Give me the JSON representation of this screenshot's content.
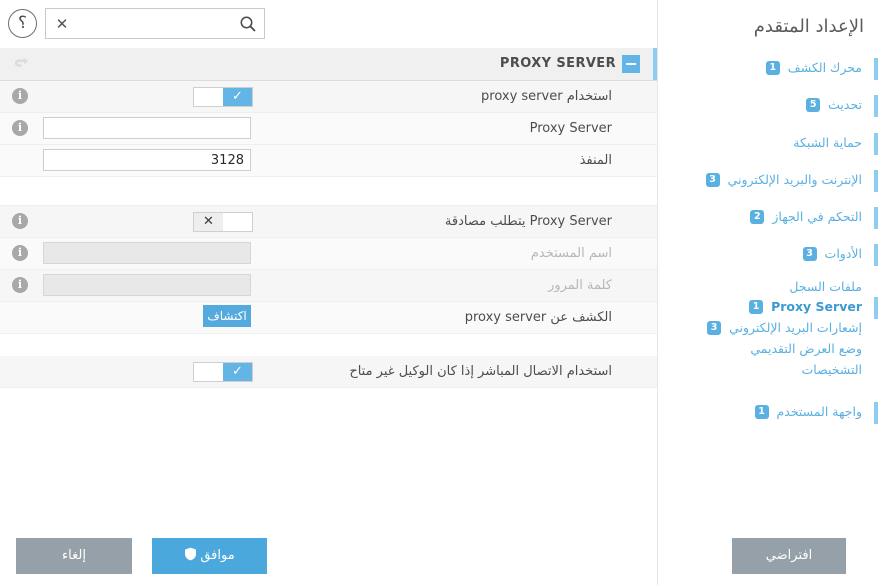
{
  "topbar": {
    "help_icon": "arabic-question-mark-icon",
    "search": {
      "value": "",
      "placeholder": "",
      "clear_glyph": "✕",
      "icon": "search-icon"
    }
  },
  "panel": {
    "title": "PROXY SERVER",
    "collapse_icon": "minus-icon",
    "undo_icon": "redo-arrow-icon",
    "rows": [
      {
        "id": "use-proxy-server",
        "label": "استخدام proxy server",
        "control": "toggle",
        "state": "on",
        "info": true,
        "mark": "✓"
      },
      {
        "id": "proxy-server-host",
        "label": "Proxy Server",
        "control": "text",
        "value": "",
        "info": true,
        "disabled": false
      },
      {
        "id": "proxy-port",
        "label": "المنفذ",
        "control": "text",
        "value": "3128",
        "info": false,
        "disabled": false
      },
      {
        "id": "proxy-requires-auth",
        "label": "Proxy Server يتطلب مصادقة",
        "control": "toggle",
        "state": "off",
        "info": true,
        "mark": "✕"
      },
      {
        "id": "username",
        "label": "اسم المستخدم",
        "control": "text",
        "value": "",
        "info": true,
        "disabled": true
      },
      {
        "id": "password",
        "label": "كلمة المرور",
        "control": "text",
        "value": "",
        "info": true,
        "disabled": true
      },
      {
        "id": "detect-proxy",
        "label": "الكشف عن proxy server",
        "control": "button",
        "button_label": "اكتشاف",
        "info": false
      },
      {
        "id": "direct-connection-fallback",
        "label": "استخدام الاتصال المباشر إذا كان الوكيل غير متاح",
        "control": "toggle",
        "state": "on",
        "info": false,
        "mark": "✓"
      }
    ]
  },
  "sidebar": {
    "title": "الإعداد المتقدم",
    "items": [
      {
        "label": "محرك الكشف",
        "badge": "1",
        "accent": true,
        "sub": false,
        "selected": false
      },
      {
        "label": "تحديث",
        "badge": "5",
        "accent": true,
        "sub": false,
        "selected": false
      },
      {
        "label": "حماية الشبكة",
        "badge": "",
        "accent": true,
        "sub": false,
        "selected": false
      },
      {
        "label": "الإنترنت والبريد الإلكتروني",
        "badge": "3",
        "accent": true,
        "sub": false,
        "selected": false
      },
      {
        "label": "التحكم في الجهاز",
        "badge": "2",
        "accent": true,
        "sub": false,
        "selected": false
      },
      {
        "label": "الأدوات",
        "badge": "3",
        "accent": true,
        "sub": false,
        "selected": false
      },
      {
        "label": "ملفات السجل",
        "badge": "",
        "accent": false,
        "sub": true,
        "selected": false
      },
      {
        "label": "Proxy Server",
        "badge": "1",
        "accent": true,
        "sub": true,
        "selected": true
      },
      {
        "label": "إشعارات البريد الإلكتروني",
        "badge": "3",
        "accent": false,
        "sub": true,
        "selected": false
      },
      {
        "label": "وضع العرض التقديمي",
        "badge": "",
        "accent": false,
        "sub": true,
        "selected": false
      },
      {
        "label": "التشخيصات",
        "badge": "",
        "accent": false,
        "sub": true,
        "selected": false
      },
      {
        "label": "واجهة المستخدم",
        "badge": "1",
        "accent": true,
        "sub": false,
        "selected": false
      }
    ]
  },
  "footer": {
    "ok_label": "موافق",
    "ok_icon": "shield-icon",
    "cancel_label": "إلغاء",
    "default_label": "افتراضي"
  },
  "colors": {
    "accent_blue": "#5ab0e0",
    "toggle_on": "#62b5e5",
    "button_blue": "#4aa8dc",
    "button_gray": "#95a0a8",
    "row_alt": "#f6f6f6",
    "row_plain": "#fafafa"
  }
}
